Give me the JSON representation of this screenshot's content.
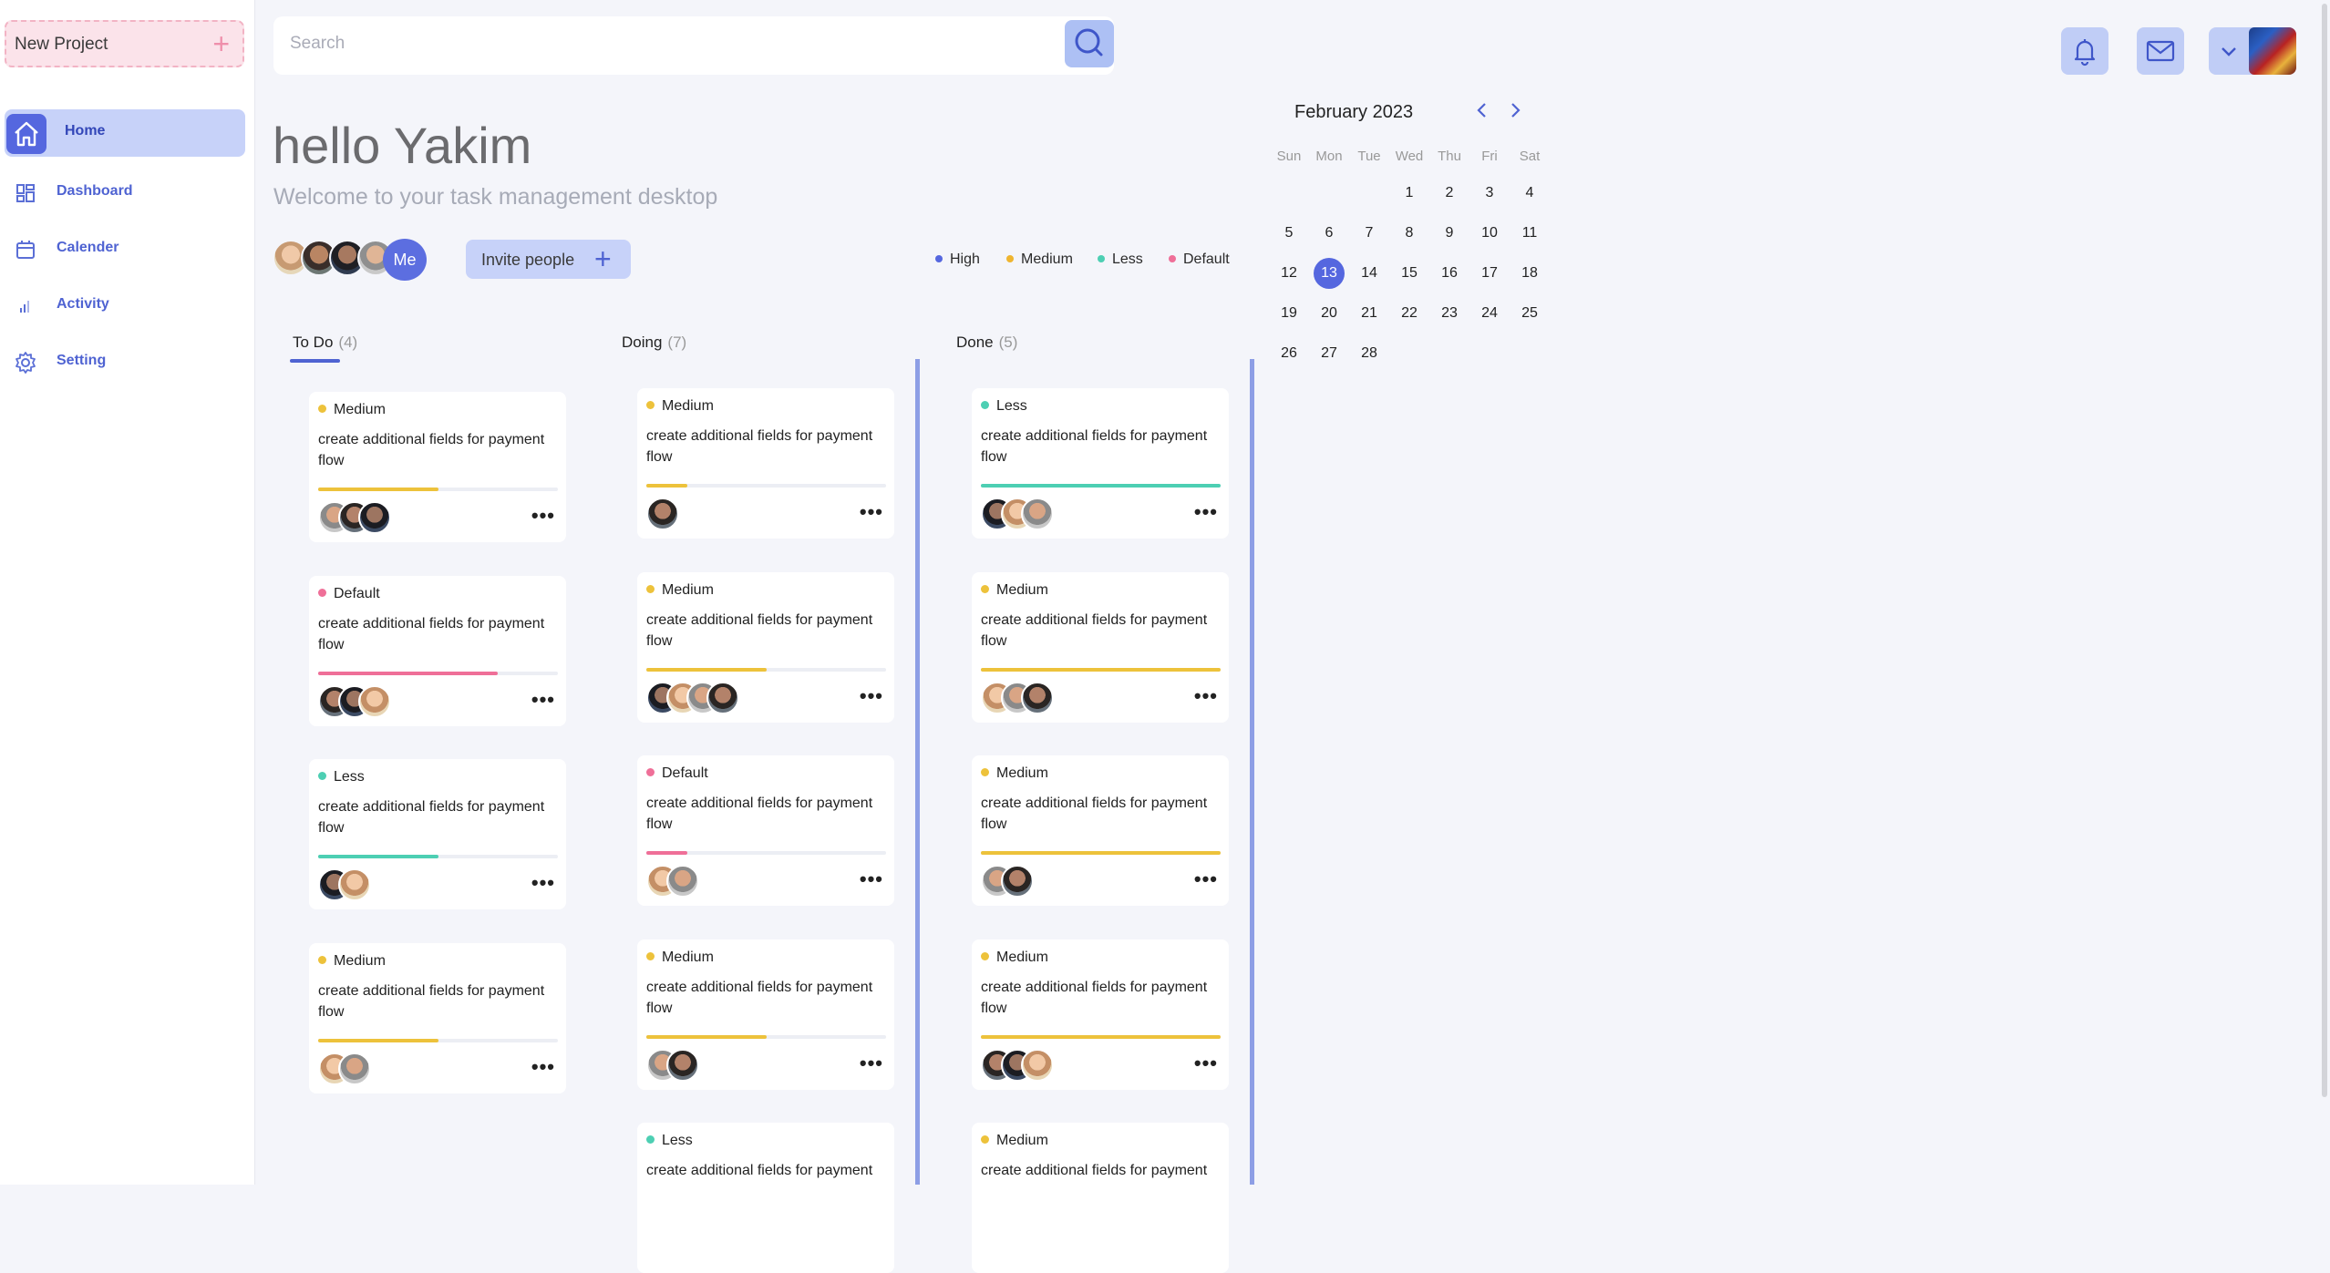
{
  "sidebar": {
    "new_project": "New Project",
    "items": [
      {
        "label": "Home",
        "icon": "home-icon",
        "active": true
      },
      {
        "label": "Dashboard",
        "icon": "dashboard-icon"
      },
      {
        "label": "Calender",
        "icon": "calendar-icon"
      },
      {
        "label": "Activity",
        "icon": "activity-icon"
      },
      {
        "label": "Setting",
        "icon": "gear-icon"
      }
    ]
  },
  "search": {
    "placeholder": "Search"
  },
  "header": {
    "greeting": "hello Yakim",
    "subtitle": "Welcome to your task management desktop",
    "me_label": "Me",
    "invite_label": "Invite people"
  },
  "legend": [
    {
      "label": "High",
      "color": "#5567df"
    },
    {
      "label": "Medium",
      "color": "#efb52f"
    },
    {
      "label": "Less",
      "color": "#4dcfb3"
    },
    {
      "label": "Default",
      "color": "#ef6f98"
    }
  ],
  "colors": {
    "accent": "#5567df",
    "medium": "#edc23b",
    "less": "#4dcfb3",
    "default": "#ef6f98"
  },
  "columns": [
    {
      "title": "To Do",
      "count": "(4)",
      "cards": [
        {
          "priority": "Medium",
          "desc": "create additional fields for payment flow",
          "progress": 0.5
        },
        {
          "priority": "Default",
          "desc": "create additional fields for payment flow",
          "progress": 0.75
        },
        {
          "priority": "Less",
          "desc": "create additional fields for payment flow",
          "progress": 0.5
        },
        {
          "priority": "Medium",
          "desc": "create additional fields for payment flow",
          "progress": 0.5
        }
      ]
    },
    {
      "title": "Doing",
      "count": "(7)",
      "cards": [
        {
          "priority": "Medium",
          "desc": "create additional fields for payment flow",
          "progress": 0.17
        },
        {
          "priority": "Medium",
          "desc": "create additional fields for payment flow",
          "progress": 0.5
        },
        {
          "priority": "Default",
          "desc": "create additional fields for payment flow",
          "progress": 0.17
        },
        {
          "priority": "Medium",
          "desc": "create additional fields for payment flow",
          "progress": 0.5
        },
        {
          "priority": "Less",
          "desc": "create additional fields for payment",
          "progress": 0
        }
      ]
    },
    {
      "title": "Done",
      "count": "(5)",
      "cards": [
        {
          "priority": "Less",
          "desc": "create additional fields for payment flow",
          "progress": 1
        },
        {
          "priority": "Medium",
          "desc": "create additional fields for payment flow",
          "progress": 1
        },
        {
          "priority": "Medium",
          "desc": "create additional fields for payment flow",
          "progress": 1
        },
        {
          "priority": "Medium",
          "desc": "create additional fields for payment flow",
          "progress": 1
        },
        {
          "priority": "Medium",
          "desc": "create additional fields for payment",
          "progress": 0
        }
      ]
    }
  ],
  "calendar": {
    "title": "February 2023",
    "weekdays": [
      "Sun",
      "Mon",
      "Tue",
      "Wed",
      "Thu",
      "Fri",
      "Sat"
    ],
    "days": [
      1,
      2,
      3,
      4,
      5,
      6,
      7,
      8,
      9,
      10,
      11,
      12,
      13,
      14,
      15,
      16,
      17,
      18,
      19,
      20,
      21,
      22,
      23,
      24,
      25,
      26,
      27,
      28
    ],
    "selected": 13,
    "first_weekday": 3
  }
}
